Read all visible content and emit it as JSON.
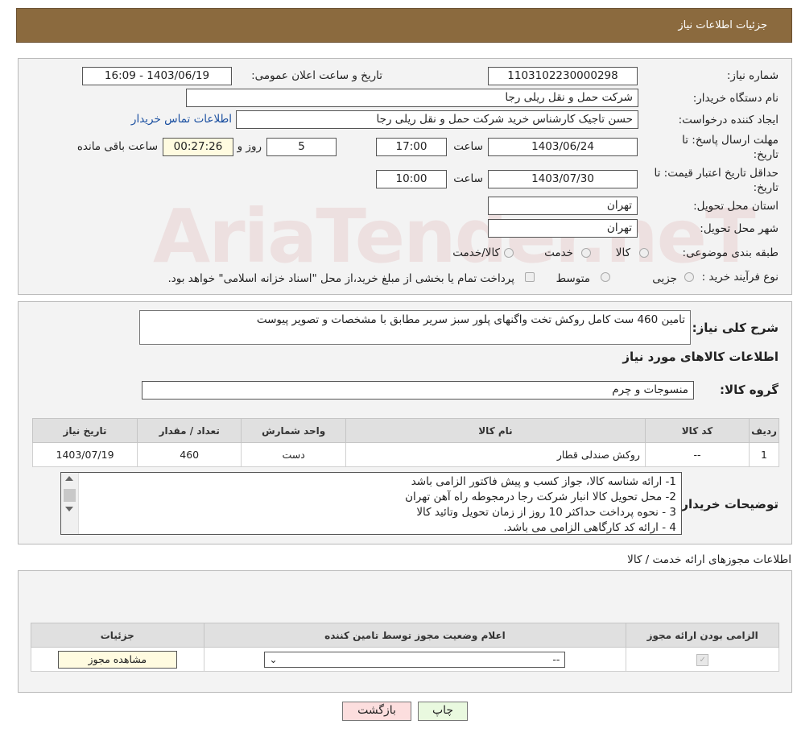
{
  "header": {
    "title": "جزئیات اطلاعات نیاز"
  },
  "watermark": {
    "text": "AriaTender.neT"
  },
  "need_number": {
    "label": "شماره نیاز:",
    "value": "1103102230000298"
  },
  "announce_date": {
    "label": "تاریخ و ساعت اعلان عمومی:",
    "value": "1403/06/19 - 16:09"
  },
  "buyer_org": {
    "label": "نام دستگاه خریدار:",
    "value": "شرکت حمل و نقل ریلی رجا"
  },
  "requester": {
    "label": "ایجاد کننده درخواست:",
    "value": "حسن تاجیک کارشناس خرید شرکت حمل و نقل ریلی رجا",
    "contact_link": "اطلاعات تماس خریدار"
  },
  "reply_deadline": {
    "label": "مهلت ارسال پاسخ: تا تاریخ:",
    "date": "1403/06/24",
    "time_label": "ساعت",
    "time": "17:00",
    "days": "5",
    "days_label": "روز و",
    "remaining": "00:27:26",
    "remaining_label": "ساعت باقی مانده"
  },
  "price_validity": {
    "label": "حداقل تاریخ اعتبار قیمت: تا تاریخ:",
    "date": "1403/07/30",
    "time_label": "ساعت",
    "time": "10:00"
  },
  "delivery_province": {
    "label": "استان محل تحویل:",
    "value": "تهران"
  },
  "delivery_city": {
    "label": "شهر محل تحویل:",
    "value": "تهران"
  },
  "category": {
    "label": "طبقه بندی موضوعی:",
    "options": [
      "کالا",
      "خدمت",
      "کالا/خدمت"
    ]
  },
  "purchase_process": {
    "label": "نوع فرآیند خرید :",
    "options": [
      "جزیی",
      "متوسط"
    ],
    "note": "پرداخت تمام یا بخشی از مبلغ خرید،از محل \"اسناد خزانه اسلامی\" خواهد بود."
  },
  "description": {
    "label": "شرح کلی نیاز:",
    "value": "تامین 460 ست کامل روکش تخت واگنهای پلور سبز سریر مطابق با مشخصات و تصویر پیوست"
  },
  "goods_info_title": "اطلاعات کالاهای مورد نیاز",
  "goods_group": {
    "label": "گروه کالا:",
    "value": "منسوجات و چرم"
  },
  "items_table": {
    "headers": [
      "ردیف",
      "کد کالا",
      "نام کالا",
      "واحد شمارش",
      "تعداد / مقدار",
      "تاریخ نیاز"
    ],
    "rows": [
      [
        "1",
        "--",
        "روکش صندلی قطار",
        "دست",
        "460",
        "1403/07/19"
      ]
    ]
  },
  "buyer_notes": {
    "label": "توضیحات خریدار:",
    "lines": [
      "1- ارائه شناسه کالا، جواز کسب و پیش فاکتور الزامی باشد",
      "2- محل تحویل کالا انبار شرکت رجا درمجوطه راه آهن تهران",
      "3 - نحوه پرداخت حداکثر 10 روز از زمان تحویل وتائید کالا",
      "4 - ارائه کد کارگاهی الزامی می باشد."
    ]
  },
  "permits_title": "اطلاعات مجوزهای ارائه خدمت / کالا",
  "permits_table": {
    "headers": [
      "الزامی بودن ارائه مجوز",
      "اعلام وضعیت مجوز توسط تامین کننده",
      "جزئیات"
    ],
    "select_value": "--",
    "view_button": "مشاهده مجوز"
  },
  "buttons": {
    "print": "چاپ",
    "back": "بازگشت"
  },
  "colors": {
    "header_bg": "#8b6a3e",
    "panel_bg": "#f3f3f3",
    "link": "#1a4fa0",
    "back_button_bg": "#fcdede",
    "print_button_bg": "#e9f9df"
  }
}
